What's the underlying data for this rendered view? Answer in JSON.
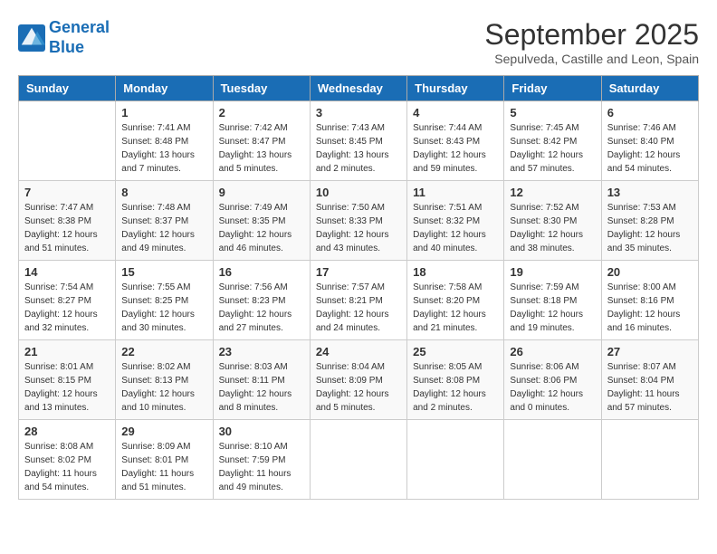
{
  "header": {
    "logo_line1": "General",
    "logo_line2": "Blue",
    "month_title": "September 2025",
    "subtitle": "Sepulveda, Castille and Leon, Spain"
  },
  "weekdays": [
    "Sunday",
    "Monday",
    "Tuesday",
    "Wednesday",
    "Thursday",
    "Friday",
    "Saturday"
  ],
  "weeks": [
    [
      {
        "day": "",
        "sunrise": "",
        "sunset": "",
        "daylight": ""
      },
      {
        "day": "1",
        "sunrise": "Sunrise: 7:41 AM",
        "sunset": "Sunset: 8:48 PM",
        "daylight": "Daylight: 13 hours and 7 minutes."
      },
      {
        "day": "2",
        "sunrise": "Sunrise: 7:42 AM",
        "sunset": "Sunset: 8:47 PM",
        "daylight": "Daylight: 13 hours and 5 minutes."
      },
      {
        "day": "3",
        "sunrise": "Sunrise: 7:43 AM",
        "sunset": "Sunset: 8:45 PM",
        "daylight": "Daylight: 13 hours and 2 minutes."
      },
      {
        "day": "4",
        "sunrise": "Sunrise: 7:44 AM",
        "sunset": "Sunset: 8:43 PM",
        "daylight": "Daylight: 12 hours and 59 minutes."
      },
      {
        "day": "5",
        "sunrise": "Sunrise: 7:45 AM",
        "sunset": "Sunset: 8:42 PM",
        "daylight": "Daylight: 12 hours and 57 minutes."
      },
      {
        "day": "6",
        "sunrise": "Sunrise: 7:46 AM",
        "sunset": "Sunset: 8:40 PM",
        "daylight": "Daylight: 12 hours and 54 minutes."
      }
    ],
    [
      {
        "day": "7",
        "sunrise": "Sunrise: 7:47 AM",
        "sunset": "Sunset: 8:38 PM",
        "daylight": "Daylight: 12 hours and 51 minutes."
      },
      {
        "day": "8",
        "sunrise": "Sunrise: 7:48 AM",
        "sunset": "Sunset: 8:37 PM",
        "daylight": "Daylight: 12 hours and 49 minutes."
      },
      {
        "day": "9",
        "sunrise": "Sunrise: 7:49 AM",
        "sunset": "Sunset: 8:35 PM",
        "daylight": "Daylight: 12 hours and 46 minutes."
      },
      {
        "day": "10",
        "sunrise": "Sunrise: 7:50 AM",
        "sunset": "Sunset: 8:33 PM",
        "daylight": "Daylight: 12 hours and 43 minutes."
      },
      {
        "day": "11",
        "sunrise": "Sunrise: 7:51 AM",
        "sunset": "Sunset: 8:32 PM",
        "daylight": "Daylight: 12 hours and 40 minutes."
      },
      {
        "day": "12",
        "sunrise": "Sunrise: 7:52 AM",
        "sunset": "Sunset: 8:30 PM",
        "daylight": "Daylight: 12 hours and 38 minutes."
      },
      {
        "day": "13",
        "sunrise": "Sunrise: 7:53 AM",
        "sunset": "Sunset: 8:28 PM",
        "daylight": "Daylight: 12 hours and 35 minutes."
      }
    ],
    [
      {
        "day": "14",
        "sunrise": "Sunrise: 7:54 AM",
        "sunset": "Sunset: 8:27 PM",
        "daylight": "Daylight: 12 hours and 32 minutes."
      },
      {
        "day": "15",
        "sunrise": "Sunrise: 7:55 AM",
        "sunset": "Sunset: 8:25 PM",
        "daylight": "Daylight: 12 hours and 30 minutes."
      },
      {
        "day": "16",
        "sunrise": "Sunrise: 7:56 AM",
        "sunset": "Sunset: 8:23 PM",
        "daylight": "Daylight: 12 hours and 27 minutes."
      },
      {
        "day": "17",
        "sunrise": "Sunrise: 7:57 AM",
        "sunset": "Sunset: 8:21 PM",
        "daylight": "Daylight: 12 hours and 24 minutes."
      },
      {
        "day": "18",
        "sunrise": "Sunrise: 7:58 AM",
        "sunset": "Sunset: 8:20 PM",
        "daylight": "Daylight: 12 hours and 21 minutes."
      },
      {
        "day": "19",
        "sunrise": "Sunrise: 7:59 AM",
        "sunset": "Sunset: 8:18 PM",
        "daylight": "Daylight: 12 hours and 19 minutes."
      },
      {
        "day": "20",
        "sunrise": "Sunrise: 8:00 AM",
        "sunset": "Sunset: 8:16 PM",
        "daylight": "Daylight: 12 hours and 16 minutes."
      }
    ],
    [
      {
        "day": "21",
        "sunrise": "Sunrise: 8:01 AM",
        "sunset": "Sunset: 8:15 PM",
        "daylight": "Daylight: 12 hours and 13 minutes."
      },
      {
        "day": "22",
        "sunrise": "Sunrise: 8:02 AM",
        "sunset": "Sunset: 8:13 PM",
        "daylight": "Daylight: 12 hours and 10 minutes."
      },
      {
        "day": "23",
        "sunrise": "Sunrise: 8:03 AM",
        "sunset": "Sunset: 8:11 PM",
        "daylight": "Daylight: 12 hours and 8 minutes."
      },
      {
        "day": "24",
        "sunrise": "Sunrise: 8:04 AM",
        "sunset": "Sunset: 8:09 PM",
        "daylight": "Daylight: 12 hours and 5 minutes."
      },
      {
        "day": "25",
        "sunrise": "Sunrise: 8:05 AM",
        "sunset": "Sunset: 8:08 PM",
        "daylight": "Daylight: 12 hours and 2 minutes."
      },
      {
        "day": "26",
        "sunrise": "Sunrise: 8:06 AM",
        "sunset": "Sunset: 8:06 PM",
        "daylight": "Daylight: 12 hours and 0 minutes."
      },
      {
        "day": "27",
        "sunrise": "Sunrise: 8:07 AM",
        "sunset": "Sunset: 8:04 PM",
        "daylight": "Daylight: 11 hours and 57 minutes."
      }
    ],
    [
      {
        "day": "28",
        "sunrise": "Sunrise: 8:08 AM",
        "sunset": "Sunset: 8:02 PM",
        "daylight": "Daylight: 11 hours and 54 minutes."
      },
      {
        "day": "29",
        "sunrise": "Sunrise: 8:09 AM",
        "sunset": "Sunset: 8:01 PM",
        "daylight": "Daylight: 11 hours and 51 minutes."
      },
      {
        "day": "30",
        "sunrise": "Sunrise: 8:10 AM",
        "sunset": "Sunset: 7:59 PM",
        "daylight": "Daylight: 11 hours and 49 minutes."
      },
      {
        "day": "",
        "sunrise": "",
        "sunset": "",
        "daylight": ""
      },
      {
        "day": "",
        "sunrise": "",
        "sunset": "",
        "daylight": ""
      },
      {
        "day": "",
        "sunrise": "",
        "sunset": "",
        "daylight": ""
      },
      {
        "day": "",
        "sunrise": "",
        "sunset": "",
        "daylight": ""
      }
    ]
  ]
}
